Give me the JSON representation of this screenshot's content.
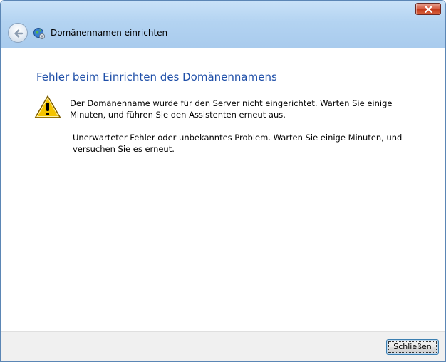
{
  "window": {
    "title": "Domänennamen einrichten",
    "title_icon": "globe-network-icon",
    "controls": {
      "close_icon": "close-icon"
    }
  },
  "navigation": {
    "back_icon": "back-arrow-icon"
  },
  "content": {
    "heading": "Fehler beim Einrichten des Domänennamens",
    "warning_icon": "warning-icon",
    "message": "Der Domänenname wurde für den Server nicht eingerichtet. Warten Sie einige Minuten, und führen Sie den Assistenten erneut aus.",
    "detail": "Unerwarteter Fehler oder unbekanntes Problem. Warten Sie einige Minuten, und versuchen Sie es erneut."
  },
  "footer": {
    "close_label": "Schließen"
  },
  "colors": {
    "heading": "#1f4fa8",
    "titlebar": "#b3d3f1",
    "close_red": "#c23a1c",
    "warning_yellow": "#f5c400"
  }
}
